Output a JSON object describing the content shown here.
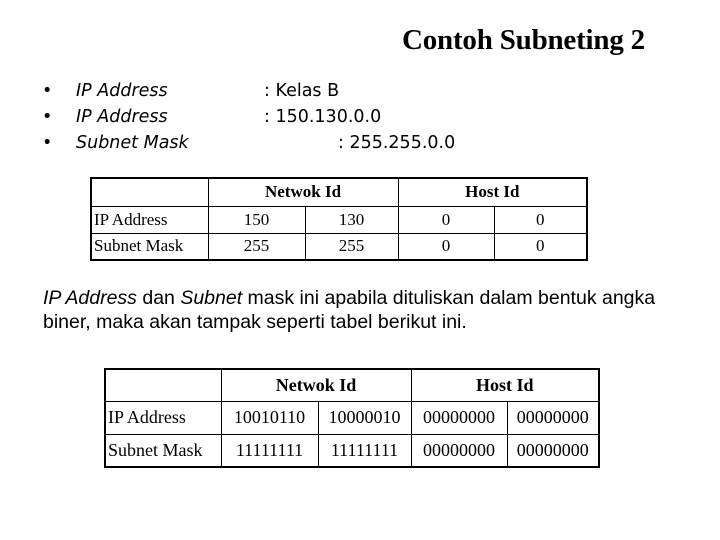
{
  "slide": {
    "title": "Contoh Subneting 2",
    "bullets": [
      {
        "label": "IP Address",
        "value": ":  Kelas B"
      },
      {
        "label": "IP Address",
        "value": ": 150.130.0.0"
      },
      {
        "label": "Subnet Mask",
        "value": ": 255.255.0.0"
      }
    ],
    "bullet_glyph": "•",
    "table_decimal": {
      "headers": [
        "",
        "Netwok Id",
        "Host Id"
      ],
      "rows": [
        {
          "label": "IP Address",
          "cells": [
            "150",
            "130",
            "0",
            "0"
          ]
        },
        {
          "label": "Subnet Mask",
          "cells": [
            "255",
            "255",
            "0",
            "0"
          ]
        }
      ]
    },
    "paragraph": {
      "italic_1": "IP Address",
      "text_1": " dan ",
      "italic_2": "Subnet",
      "text_2": " mask ini apabila dituliskan dalam bentuk angka biner, maka akan tampak seperti tabel berikut ini."
    },
    "table_binary": {
      "headers": [
        "",
        "Netwok Id",
        "Host Id"
      ],
      "rows": [
        {
          "label": "IP Address",
          "cells": [
            "10010110",
            "10000010",
            "00000000",
            "00000000"
          ]
        },
        {
          "label": "Subnet Mask",
          "cells": [
            "11111111",
            "11111111",
            "00000000",
            "00000000"
          ]
        }
      ]
    }
  }
}
